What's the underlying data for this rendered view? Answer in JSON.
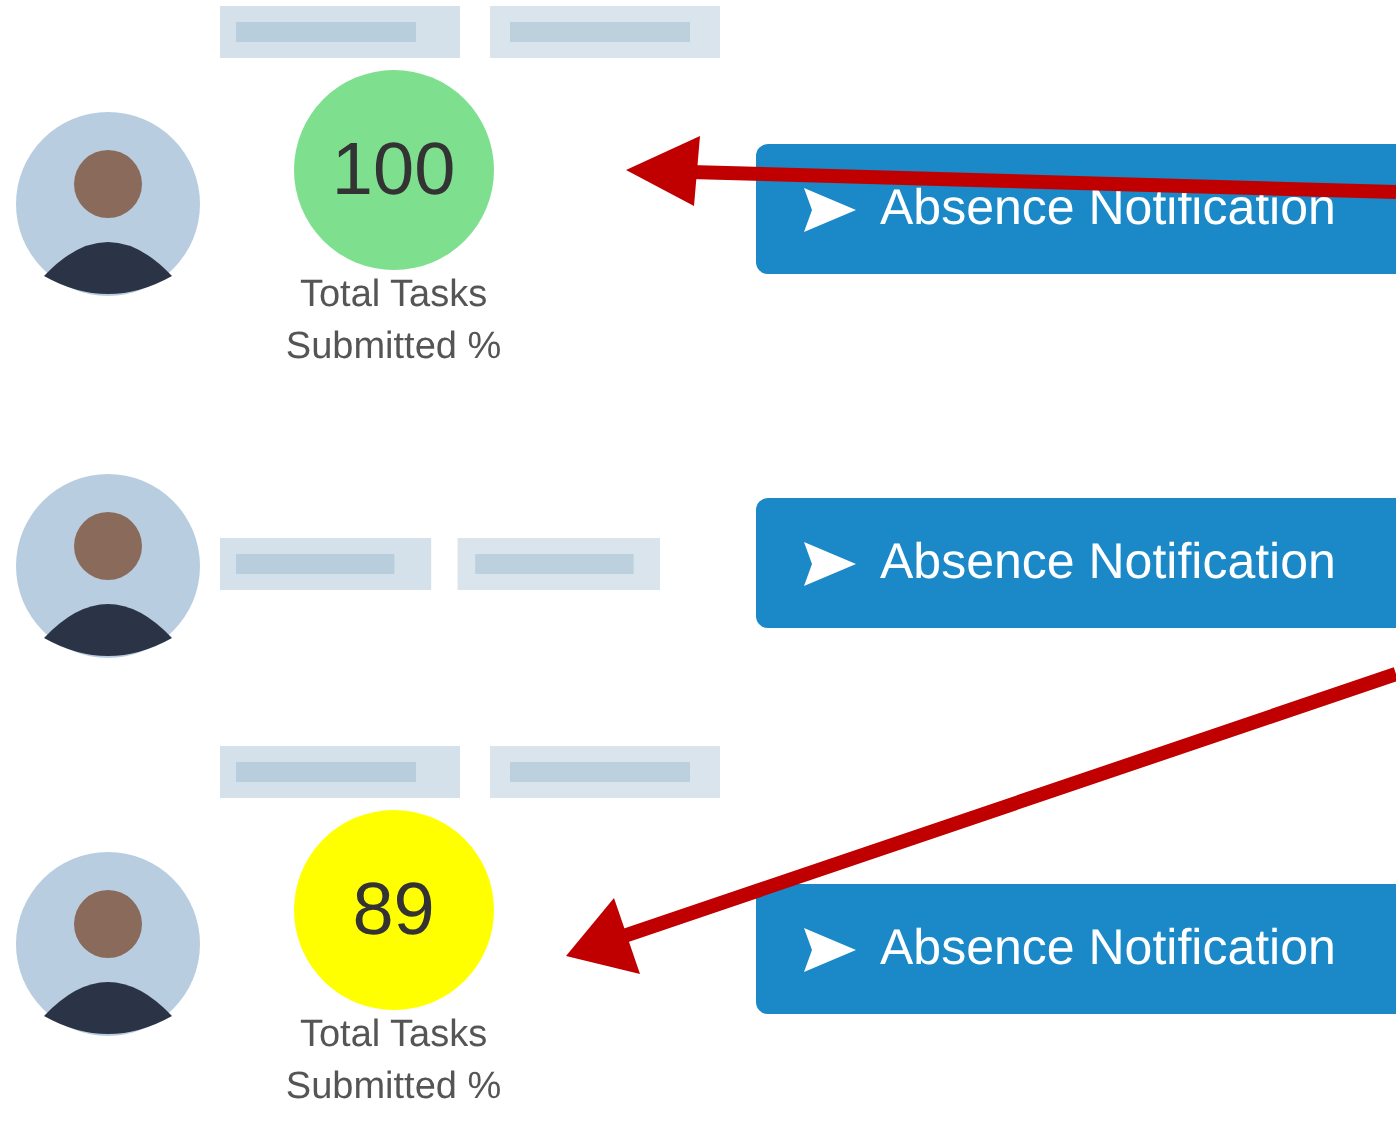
{
  "students": [
    {
      "kind": "score",
      "score": "100",
      "color": "#7ee08e",
      "score_label": [
        "Total Tasks",
        "Submitted %"
      ],
      "button": "Absence Notification"
    },
    {
      "kind": "name_only",
      "button": "Absence Notification"
    },
    {
      "kind": "score",
      "score": "89",
      "color": "#ffff00",
      "score_label": [
        "Total Tasks",
        "Submitted %"
      ],
      "button": "Absence Notification"
    }
  ]
}
